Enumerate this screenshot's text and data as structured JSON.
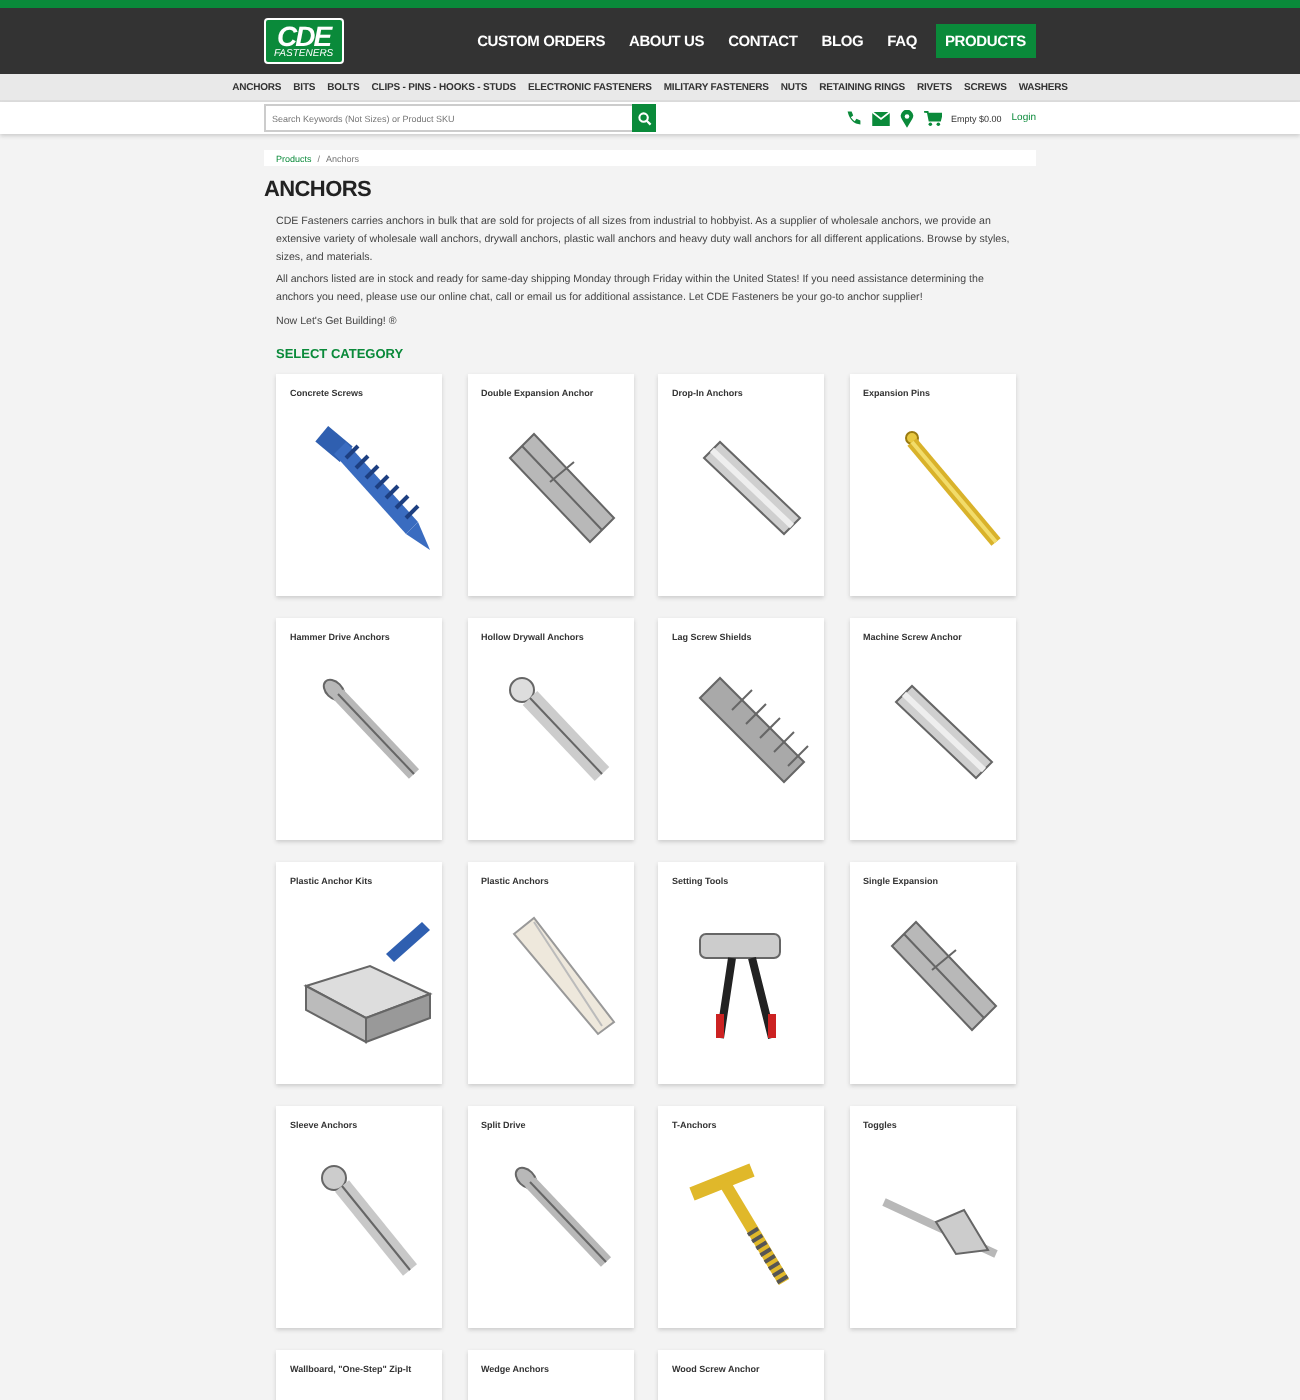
{
  "header": {
    "logo": {
      "title": "CDE",
      "subtitle": "FASTENERS"
    },
    "nav": [
      {
        "label": "CUSTOM ORDERS",
        "selected": false
      },
      {
        "label": "ABOUT US",
        "selected": false
      },
      {
        "label": "CONTACT",
        "selected": false
      },
      {
        "label": "BLOG",
        "selected": false
      },
      {
        "label": "FAQ",
        "selected": false
      },
      {
        "label": "PRODUCTS",
        "selected": true
      }
    ]
  },
  "categories_bar": [
    "ANCHORS",
    "BITS",
    "BOLTS",
    "CLIPS - PINS - HOOKS - STUDS",
    "ELECTRONIC FASTENERS",
    "MILITARY FASTENERS",
    "NUTS",
    "RETAINING RINGS",
    "RIVETS",
    "SCREWS",
    "WASHERS"
  ],
  "search": {
    "placeholder": "Search Keywords (Not Sizes) or Product SKU"
  },
  "cart": {
    "label": "Empty $0.00",
    "login": "Login"
  },
  "breadcrumb": {
    "items": [
      "Products",
      "Anchors"
    ],
    "separator": "/"
  },
  "title": "ANCHORS",
  "intro": [
    "CDE Fasteners carries anchors in bulk that are sold for projects of all sizes from industrial to hobbyist. As a supplier of wholesale anchors, we provide an extensive variety of wholesale wall anchors, drywall anchors, plastic wall anchors and heavy duty wall anchors for all different applications. Browse by styles, sizes, and materials.",
    "All anchors listed are in stock and ready for same-day shipping Monday through Friday within the United States! If you need assistance determining the anchors you need, please use our online chat, call or email us for additional assistance. Let CDE Fasteners be your go-to anchor supplier!",
    "Now Let's Get Building! ®"
  ],
  "section_title": "SELECT CATEGORY",
  "products": [
    {
      "name": "Concrete Screws",
      "kind": "screw"
    },
    {
      "name": "Double Expansion Anchor",
      "kind": "sleeve"
    },
    {
      "name": "Drop-In Anchors",
      "kind": "tube"
    },
    {
      "name": "Expansion Pins",
      "kind": "pin"
    },
    {
      "name": "Hammer Drive Anchors",
      "kind": "nail"
    },
    {
      "name": "Hollow Drywall Anchors",
      "kind": "molly"
    },
    {
      "name": "Lag Screw Shields",
      "kind": "shield"
    },
    {
      "name": "Machine Screw Anchor",
      "kind": "tube"
    },
    {
      "name": "Plastic Anchor Kits",
      "kind": "kit"
    },
    {
      "name": "Plastic Anchors",
      "kind": "plastic"
    },
    {
      "name": "Setting Tools",
      "kind": "tool"
    },
    {
      "name": "Single Expansion",
      "kind": "sleeve"
    },
    {
      "name": "Sleeve Anchors",
      "kind": "bolt"
    },
    {
      "name": "Split Drive",
      "kind": "nail"
    },
    {
      "name": "T-Anchors",
      "kind": "tanchor"
    },
    {
      "name": "Toggles",
      "kind": "toggle"
    },
    {
      "name": "Wallboard, \"One-Step\" Zip-It"
    },
    {
      "name": "Wedge Anchors"
    },
    {
      "name": "Wood Screw Anchor"
    }
  ]
}
